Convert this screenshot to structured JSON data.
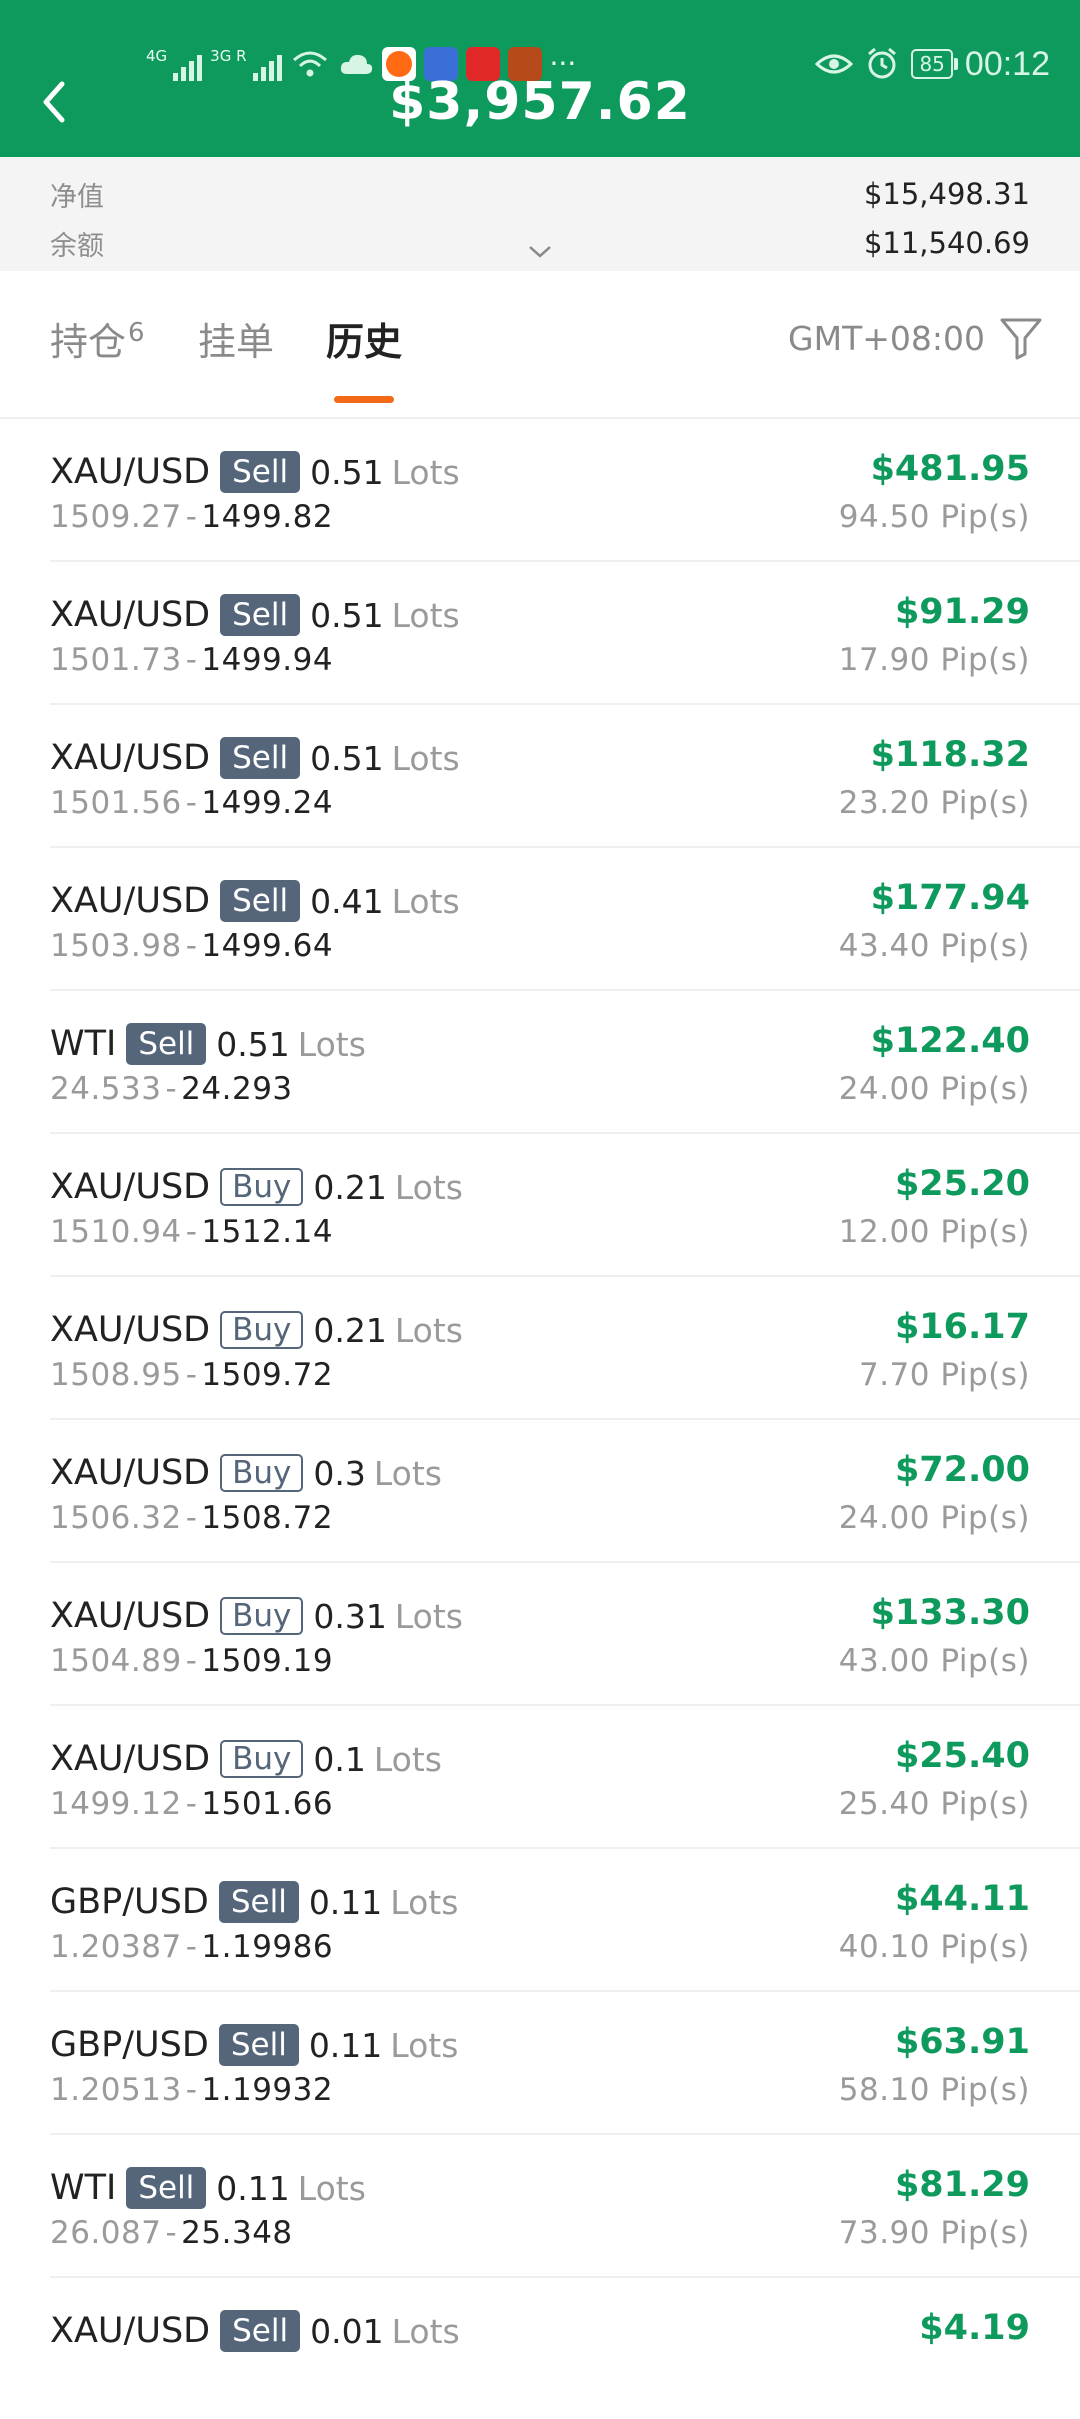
{
  "status_bar": {
    "signal1_label": "4G",
    "signal2_label": "3G R",
    "battery": "85",
    "time": "00:12",
    "app_icon_colors": [
      "#ff6a13",
      "#3b6fd8",
      "#e02828",
      "#b64a1a"
    ]
  },
  "header": {
    "balance": "$3,957.62"
  },
  "summary": {
    "equity_label": "净值",
    "equity_value": "$15,498.31",
    "balance_label": "余额",
    "balance_value": "$11,540.69"
  },
  "tabs": {
    "positions_label": "持仓",
    "positions_count": "6",
    "pending_label": "挂单",
    "history_label": "历史",
    "timezone": "GMT+08:00"
  },
  "trades": [
    {
      "symbol": "XAU/USD",
      "side": "Sell",
      "qty": "0.51",
      "lots": "Lots",
      "open": "1509.27",
      "close": "1499.82",
      "profit": "$481.95",
      "pips": "94.50 Pip(s)"
    },
    {
      "symbol": "XAU/USD",
      "side": "Sell",
      "qty": "0.51",
      "lots": "Lots",
      "open": "1501.73",
      "close": "1499.94",
      "profit": "$91.29",
      "pips": "17.90 Pip(s)"
    },
    {
      "symbol": "XAU/USD",
      "side": "Sell",
      "qty": "0.51",
      "lots": "Lots",
      "open": "1501.56",
      "close": "1499.24",
      "profit": "$118.32",
      "pips": "23.20 Pip(s)"
    },
    {
      "symbol": "XAU/USD",
      "side": "Sell",
      "qty": "0.41",
      "lots": "Lots",
      "open": "1503.98",
      "close": "1499.64",
      "profit": "$177.94",
      "pips": "43.40 Pip(s)"
    },
    {
      "symbol": "WTI",
      "side": "Sell",
      "qty": "0.51",
      "lots": "Lots",
      "open": "24.533",
      "close": "24.293",
      "profit": "$122.40",
      "pips": "24.00 Pip(s)"
    },
    {
      "symbol": "XAU/USD",
      "side": "Buy",
      "qty": "0.21",
      "lots": "Lots",
      "open": "1510.94",
      "close": "1512.14",
      "profit": "$25.20",
      "pips": "12.00 Pip(s)"
    },
    {
      "symbol": "XAU/USD",
      "side": "Buy",
      "qty": "0.21",
      "lots": "Lots",
      "open": "1508.95",
      "close": "1509.72",
      "profit": "$16.17",
      "pips": "7.70 Pip(s)"
    },
    {
      "symbol": "XAU/USD",
      "side": "Buy",
      "qty": "0.3",
      "lots": "Lots",
      "open": "1506.32",
      "close": "1508.72",
      "profit": "$72.00",
      "pips": "24.00 Pip(s)"
    },
    {
      "symbol": "XAU/USD",
      "side": "Buy",
      "qty": "0.31",
      "lots": "Lots",
      "open": "1504.89",
      "close": "1509.19",
      "profit": "$133.30",
      "pips": "43.00 Pip(s)"
    },
    {
      "symbol": "XAU/USD",
      "side": "Buy",
      "qty": "0.1",
      "lots": "Lots",
      "open": "1499.12",
      "close": "1501.66",
      "profit": "$25.40",
      "pips": "25.40 Pip(s)"
    },
    {
      "symbol": "GBP/USD",
      "side": "Sell",
      "qty": "0.11",
      "lots": "Lots",
      "open": "1.20387",
      "close": "1.19986",
      "profit": "$44.11",
      "pips": "40.10 Pip(s)"
    },
    {
      "symbol": "GBP/USD",
      "side": "Sell",
      "qty": "0.11",
      "lots": "Lots",
      "open": "1.20513",
      "close": "1.19932",
      "profit": "$63.91",
      "pips": "58.10 Pip(s)"
    },
    {
      "symbol": "WTI",
      "side": "Sell",
      "qty": "0.11",
      "lots": "Lots",
      "open": "26.087",
      "close": "25.348",
      "profit": "$81.29",
      "pips": "73.90 Pip(s)"
    },
    {
      "symbol": "XAU/USD",
      "side": "Sell",
      "qty": "0.01",
      "lots": "Lots",
      "open": "",
      "close": "",
      "profit": "$4.19",
      "pips": ""
    }
  ],
  "colors": {
    "brand_green": "#0e9a5c",
    "accent_orange": "#f26a18",
    "sell_badge": "#56667a"
  }
}
